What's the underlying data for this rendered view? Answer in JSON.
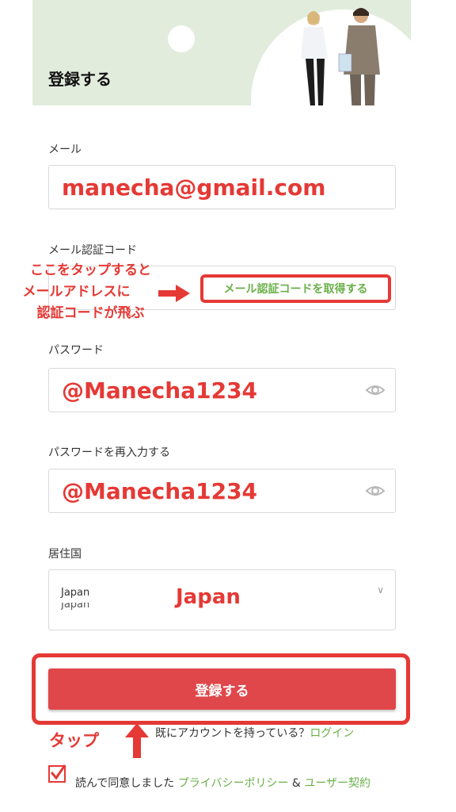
{
  "header": {
    "title": "登録する"
  },
  "email": {
    "label": "メール",
    "value": "manecha@gmail.com"
  },
  "code": {
    "label": "メール認証コード",
    "get_code_label": "メール認証コードを取得する"
  },
  "annotation": {
    "line1": "ここをタップすると",
    "line2": "メールアドレスに",
    "line3": "認証コードが飛ぶ"
  },
  "password": {
    "label": "パスワード",
    "value": "@Manecha1234"
  },
  "password_confirm": {
    "label": "パスワードを再入力する",
    "value": "@Manecha1234"
  },
  "country": {
    "label": "居住国",
    "selected": "Japan",
    "selected_dup": "Japan",
    "overlay": "Japan"
  },
  "register_button": {
    "label": "登録する"
  },
  "login": {
    "prompt": "既にアカウントを持っている？",
    "link": "ログイン"
  },
  "tap_label": "タップ",
  "agreement": {
    "prefix": "読んで同意しました ",
    "privacy": "プライバシーポリシー",
    "amp": " & ",
    "terms": "ユーザー契約"
  },
  "colors": {
    "accent": "#e53935",
    "link_green": "#6bb04a",
    "header_bg": "#e1ecdd",
    "button": "#e0474a"
  }
}
